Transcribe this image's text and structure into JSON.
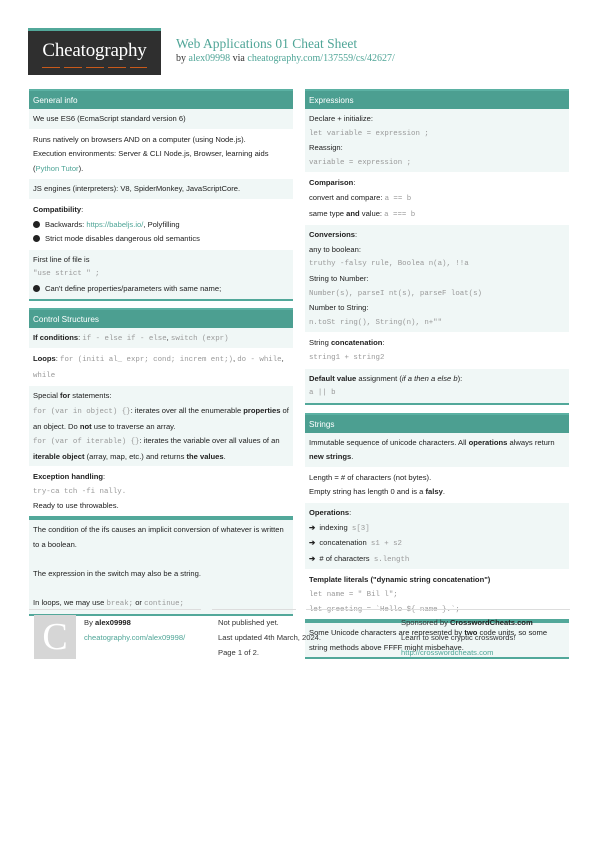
{
  "header": {
    "logo": "Cheatography",
    "title": "Web Applications 01 Cheat Sheet",
    "by": "by",
    "author": "alex09998",
    "via": "via",
    "url": "cheatography.com/137559/cs/42627/"
  },
  "general_info": {
    "title": "General info",
    "es6": "We use ES6 (EcmaScript standard version 6)",
    "runs": "Runs natively on browsers AND on a computer (using Node.js).",
    "exec_prefix": "Execution environments: Server & CLI Node.js, Browser, learning aids (",
    "exec_link": "Python Tutor",
    "exec_suffix": ").",
    "engines": "JS engines (interpreters): V8, SpiderMonkey, JavaScriptCore.",
    "compat_title": "Compatibility",
    "compat_colon": ":",
    "compat_b1_prefix": "Backwards: ",
    "compat_b1_link": "https://babeljs.io/",
    "compat_b1_suffix": ", Polyfilling",
    "compat_b2": "Strict mode disables dangerous old semantics",
    "first_line": "First line of file is",
    "use_strict": "\"use strict \" ;",
    "cant_define": "Can't define properties/parameters with same name;"
  },
  "control": {
    "title": "Control Structures",
    "if_label": "If conditions",
    "if_colon": ": ",
    "if_code1": "if - else if - else",
    "if_sep": ", ",
    "if_code2": "switch (expr)",
    "loops_label": "Loops",
    "loops_colon": ": ",
    "loops_code1": "for (initi al_ expr; cond; increm ent;)",
    "loops_sep1": ", ",
    "loops_code2": "do - while",
    "loops_sep2": ", ",
    "loops_code3": "while",
    "special_pre": "Special ",
    "special_for": "for",
    "special_post": " statements:",
    "forin_code": "for (var in object) {}",
    "forin_text1": ": iterates over all the enumerable ",
    "forin_bold": "properties",
    "forin_text2": " of an object. Do ",
    "forin_not": "not",
    "forin_text3": " use to traverse an array.",
    "forof_code": "for (var of iterable) {}",
    "forof_text1": ": iterates the variable over all values of an ",
    "forof_bold": "iterable object",
    "forof_text2": " (array, map, etc.) and returns ",
    "forof_bold2": "the values",
    "forof_text3": ".",
    "exc_label": "Exception handling",
    "exc_colon": ":",
    "exc_code": "try-ca tch -fi nally.",
    "exc_ready": "Ready to use throwables."
  },
  "notes": {
    "ifs": "The condition of the ifs causes an implicit conversion of whatever is written to a boolean.",
    "switch": "The expression in the switch may also be a string.",
    "loops_prefix": "In loops, we may use ",
    "loops_break": "break;",
    "loops_or": " or ",
    "loops_continue": "continue;"
  },
  "expressions": {
    "title": "Expressions",
    "declare": "Declare + initialize:",
    "declare_code": "let variable = expression ;",
    "reassign": "Reassign:",
    "reassign_code": "variable = expression ;",
    "comparison": "Comparison",
    "comparison_colon": ":",
    "convert_label": "convert and compare: ",
    "convert_code": "a == b",
    "same_label1": "same type ",
    "same_and": "and",
    "same_label2": " value: ",
    "same_code": "a === b",
    "conversions": "Conversions",
    "conversions_colon": ":",
    "to_bool": "any to boolean:",
    "to_bool_code": "truthy -falsy rule, Boolea n(a), !!a",
    "str_to_num": "String to Number:",
    "str_to_num_code": "Number(s), parseI nt(s), parseF loat(s)",
    "num_to_str": "Number to String:",
    "num_to_str_code": "n.toSt ring(), String(n), n+\"\"",
    "concat_pre": "String ",
    "concat_bold": "concatenation",
    "concat_colon": ":",
    "concat_code": "string1 + string2",
    "default_bold": "Default value",
    "default_text": " assignment (",
    "default_italic": "if a then a else b",
    "default_end": "):",
    "default_code": "a || b"
  },
  "strings": {
    "title": "Strings",
    "immutable1": "Immutable sequence of unicode characters. All ",
    "immutable_ops": "operations",
    "immutable2": " always return ",
    "immutable_new": "new strings",
    "immutable3": ".",
    "length": "Length = # of characters (not bytes).",
    "empty1": "Empty string has length 0 and is a ",
    "empty_falsy": "falsy",
    "empty2": ".",
    "operations": "Operations",
    "operations_colon": ":",
    "ops": [
      {
        "label": "indexing",
        "code": "s[3]"
      },
      {
        "label": "concatenation",
        "code": "s1 + s2"
      },
      {
        "label": "# of characters",
        "code": "s.length"
      }
    ],
    "template_title": "Template literals (\"dynamic string concatenation\")",
    "template_code1": "let name = \" Bil l\";",
    "template_code2": "let greeting = `Hello ${ name }.`;",
    "unicode1": "Some Unicode characters are represented by ",
    "unicode_two": "two",
    "unicode2": " code units, so some string methods above FFFF might misbehave."
  },
  "footer": {
    "avatar_letter": "C",
    "by": "By ",
    "author": "alex09998",
    "author_url": "cheatography.com/alex09998/",
    "published": "Not published yet.",
    "updated": "Last updated 4th March, 2024.",
    "page": "Page 1 of 2.",
    "sponsored": "Sponsored by ",
    "sponsor": "CrosswordCheats.com",
    "sponsor_tag": "Learn to solve cryptic crosswords!",
    "sponsor_url": "http://crosswordcheats.com"
  }
}
